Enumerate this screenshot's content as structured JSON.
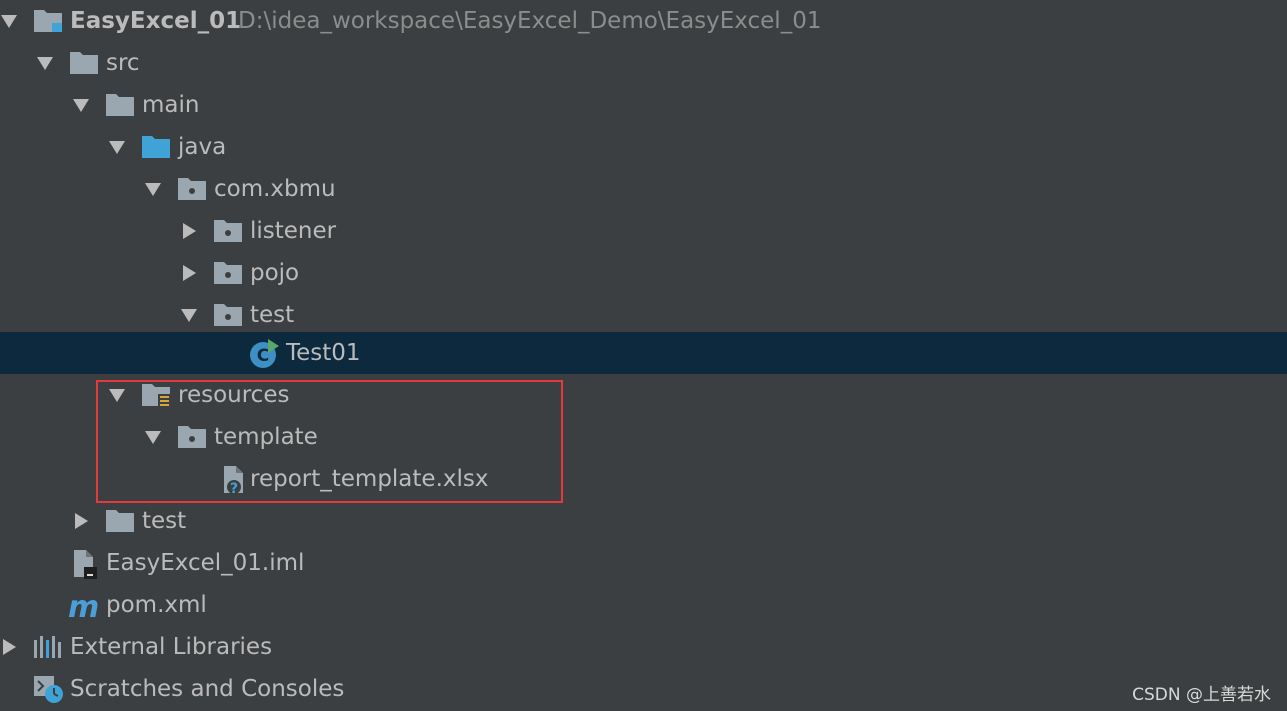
{
  "project": {
    "name": "EasyExcel_01",
    "path": "D:\\idea_workspace\\EasyExcel_Demo\\EasyExcel_01"
  },
  "tree": {
    "src": "src",
    "main": "main",
    "java": "java",
    "package": "com.xbmu",
    "listener": "listener",
    "pojo": "pojo",
    "test_pkg": "test",
    "test01": "Test01",
    "resources": "resources",
    "template": "template",
    "report_file": "report_template.xlsx",
    "test_dir": "test",
    "iml": "EasyExcel_01.iml",
    "pom": "pom.xml",
    "external_libraries": "External Libraries",
    "scratches": "Scratches and Consoles"
  },
  "watermark": "CSDN @上善若水",
  "colors": {
    "background": "#3c3f41",
    "selection": "#0d293e",
    "text": "#bbbbbb",
    "highlight_border": "#e33b3b",
    "folder_gray": "#9aa7b0",
    "folder_blue": "#40a3d8"
  },
  "icons": {
    "module": "module-folder-icon",
    "folder": "folder-icon",
    "source_root": "source-root-folder-icon",
    "package": "package-icon",
    "resources_root": "resources-root-folder-icon",
    "class": "java-class-icon",
    "unknown_file": "unknown-file-icon",
    "iml": "iml-file-icon",
    "maven": "maven-icon",
    "libraries": "libraries-icon",
    "scratches": "scratches-icon"
  }
}
